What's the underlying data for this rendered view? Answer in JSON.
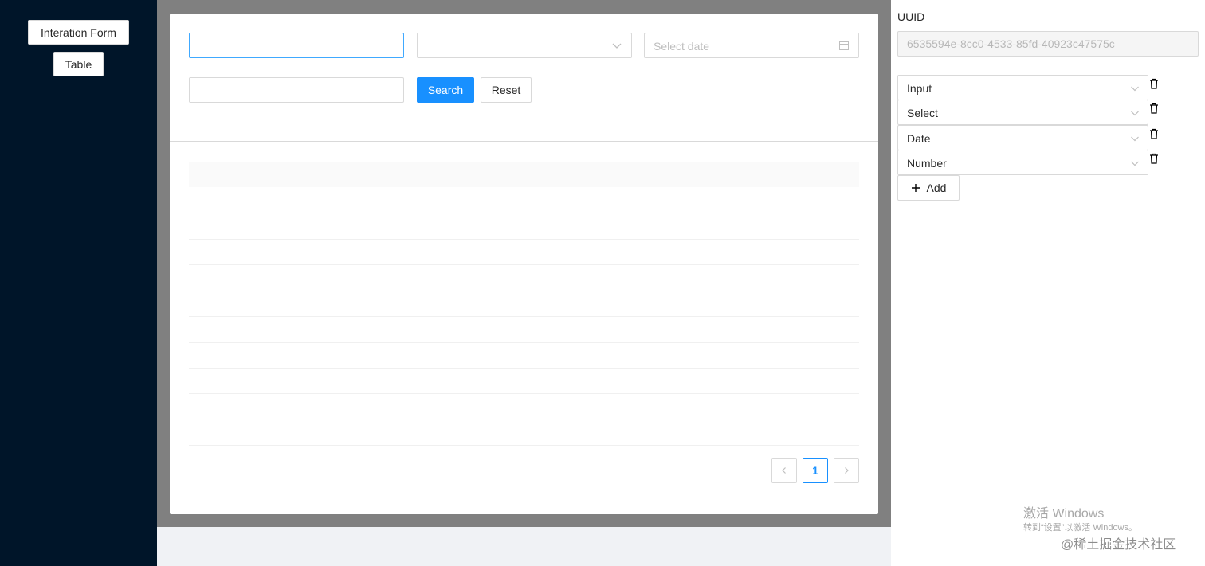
{
  "sidebar": {
    "buttons": [
      {
        "label": "Interation Form"
      },
      {
        "label": "Table"
      }
    ]
  },
  "form": {
    "date_placeholder": "Select date",
    "search_label": "Search",
    "reset_label": "Reset"
  },
  "table": {
    "pagination": {
      "current_page": "1"
    }
  },
  "right_panel": {
    "uuid_label": "UUID",
    "uuid_value": "6535594e-8cc0-4533-85fd-40923c47575c",
    "fields": [
      {
        "type": "Input"
      },
      {
        "type": "Select"
      },
      {
        "type": "Date"
      },
      {
        "type": "Number"
      }
    ],
    "add_label": "Add"
  },
  "watermark": {
    "line1": "激活 Windows",
    "line2": "转到“设置”以激活 Windows。"
  },
  "credit": "@稀土掘金技术社区",
  "colors": {
    "sidebar_bg": "#001529",
    "primary": "#1890ff",
    "frame_bg": "#808080",
    "page_bg": "#f0f2f5"
  }
}
